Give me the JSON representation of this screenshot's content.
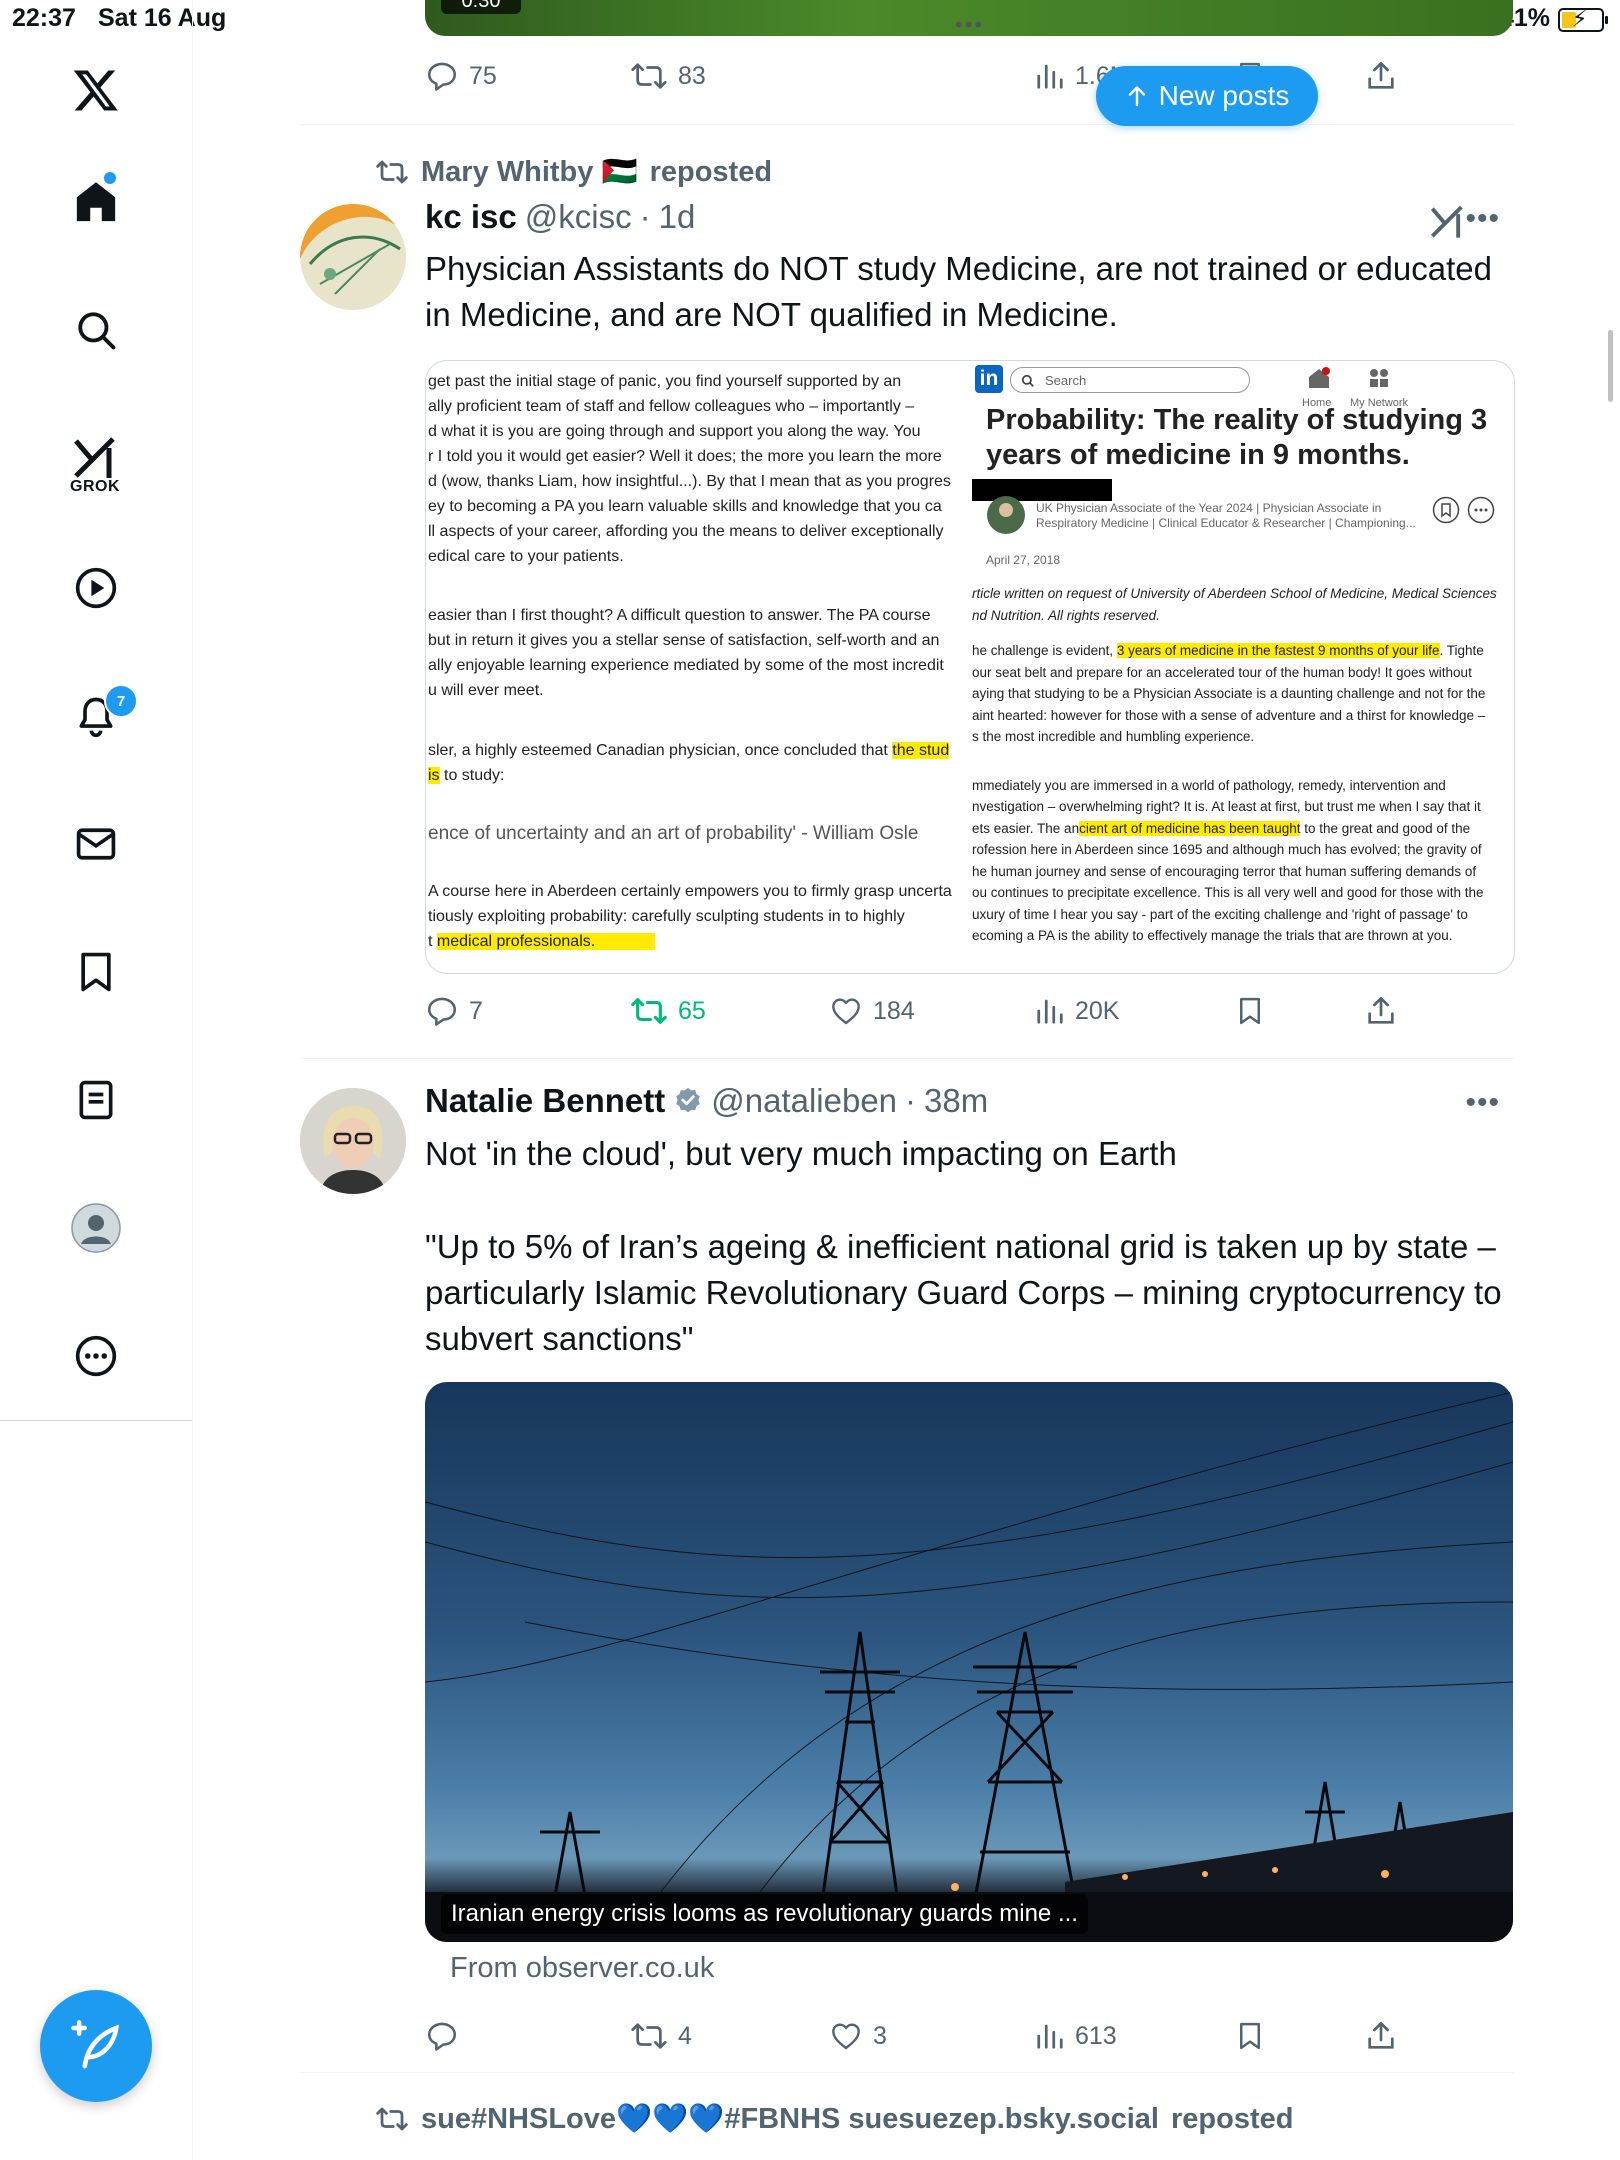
{
  "status_bar": {
    "time": "22:37",
    "date": "Sat 16 Aug",
    "battery": "41%"
  },
  "sidebar": {
    "grok_label": "GROK",
    "notifications_badge": "7"
  },
  "new_posts_pill": {
    "label": "New posts"
  },
  "tweet0": {
    "video_duration": "0:30",
    "stats": {
      "replies": "75",
      "reposts": "83",
      "views": "1.6M"
    }
  },
  "tweet1": {
    "reposted_by": "Mary Whitby 🇵🇸",
    "reposted_label": "reposted",
    "name": "kc isc",
    "handle": "@kcisc",
    "time": "1d",
    "text": "Physician Assistants do NOT study Medicine, are not trained or educated in Medicine, and are NOT qualified in Medicine.",
    "image_left_lines": [
      "get past the initial stage of panic, you find yourself supported by an",
      "ally proficient team of staff and fellow colleagues who – importantly –",
      "d what it is you are going through and support you along the way.  You",
      "r I told you it would get easier? Well it does; the more you learn the more",
      "d (wow, thanks Liam, how insightful...). By that I mean that as you progres",
      "ey to becoming a PA you learn valuable skills and knowledge that you ca",
      "ll aspects of your career, affording you the means to deliver exceptionally",
      "edical care to your patients."
    ],
    "image_left_lines_2": [
      "easier than I first thought? A difficult question to answer.  The PA course",
      " but in return it gives you a stellar sense of satisfaction, self-worth and an",
      "ally enjoyable learning experience mediated by some of the most incredit",
      "u will ever meet."
    ],
    "image_left_osler_a": "sler, a highly esteemed Canadian physician, once concluded that ",
    "image_left_osler_hl": "the stud",
    "image_left_osler_b_hl": "is",
    "image_left_osler_b": " to study:",
    "image_left_quote": "ence of uncertainty and an art of probability' - William Osle",
    "image_left_lines_3": [
      "A course here in Aberdeen certainly empowers you to firmly grasp uncerta",
      "tiously exploiting probability: carefully sculpting students in to highly"
    ],
    "image_left_last_pre": "t ",
    "image_left_last_hl": "medical professionals.",
    "image_right": {
      "search_placeholder": "Search",
      "home": "Home",
      "network": "My Network",
      "title": "Probability: The reality of studying 3 years of medicine in 9 months.",
      "author_meta": "UK Physician Associate of the Year 2024 | Physician Associate in Respiratory Medicine | Clinical Educator & Researcher | Championing...",
      "date": "April 27, 2018",
      "intro_1": "rticle written on request of University of Aberdeen School of Medicine, Medical Sciences",
      "intro_2": "nd Nutrition. All rights reserved.",
      "p1_pre": "he challenge is evident, ",
      "p1_hl": "3 years of medicine in the fastest 9 months of your life",
      "p1_post": ".  Tighte",
      "p1_lines": [
        "our seat belt and prepare for an accelerated tour of the human body!  It goes without",
        "aying that studying to be a Physician Associate is a daunting challenge and not for the",
        "aint hearted: however for those with a sense of adventure and a thirst for knowledge –",
        "s the most incredible and humbling experience."
      ],
      "p2_lines_a": [
        "mmediately you are immersed in a world of pathology, remedy, intervention and",
        "nvestigation – overwhelming right? It is. At least at first, but trust me when I say that it"
      ],
      "p2_hl_pre": "ets easier.  The an",
      "p2_hl": "cient art of medicine has been taught",
      "p2_hl_post": " to the great and good of the",
      "p2_lines_b": [
        "rofession here in Aberdeen since 1695 and although much has evolved; the gravity of",
        "he human journey and sense of encouraging terror that human suffering demands of",
        "ou continues to precipitate excellence.  This is all very well and good for those with the",
        "uxury of time I hear you say - part of the exciting challenge and 'right of passage' to",
        "ecoming a PA is the ability to effectively manage the trials that are thrown at you."
      ]
    },
    "stats": {
      "replies": "7",
      "reposts": "65",
      "likes": "184",
      "views": "20K"
    }
  },
  "tweet2": {
    "name": "Natalie Bennett",
    "handle": "@natalieben",
    "time": "38m",
    "text_1": "Not 'in the cloud', but very much impacting on Earth",
    "text_2": "\"Up to 5% of Iran’s ageing & inefficient national grid is taken up by state – particularly Islamic Revolutionary Guard Corps – mining cryptocurrency to subvert sanctions\"",
    "card_caption": "Iranian energy crisis looms as revolutionary guards mine ...",
    "card_source": "From observer.co.uk",
    "stats": {
      "replies": "",
      "reposts": "4",
      "likes": "3",
      "views": "613"
    }
  },
  "tweet3": {
    "reposted_by": "sue#NHSLove💙💙💙#FBNHS suesuezep.bsky.social",
    "reposted_label": "reposted"
  },
  "colors": {
    "accent": "#1d9bf0",
    "repost_active": "#00ba7c",
    "muted": "#536471"
  }
}
